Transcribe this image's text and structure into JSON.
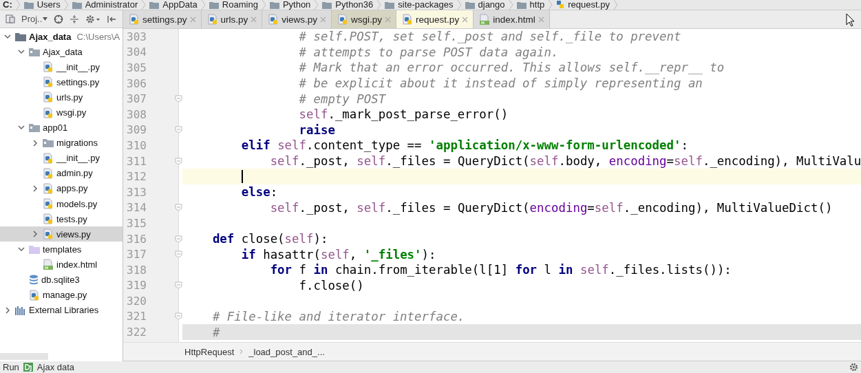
{
  "path_bar": [
    "C:",
    "Users",
    "Administrator",
    "AppData",
    "Roaming",
    "Python",
    "Python36",
    "site-packages",
    "django",
    "http",
    "request.py"
  ],
  "project_toolbar": {
    "label": "Proj.."
  },
  "tabs": [
    {
      "label": "settings.py",
      "kind": "py",
      "selected": false,
      "tinted": false
    },
    {
      "label": "urls.py",
      "kind": "py",
      "selected": false,
      "tinted": false
    },
    {
      "label": "views.py",
      "kind": "py",
      "selected": false,
      "tinted": false
    },
    {
      "label": "wsgi.py",
      "kind": "py",
      "selected": false,
      "tinted": true
    },
    {
      "label": "request.py",
      "kind": "py",
      "selected": true,
      "tinted": false
    },
    {
      "label": "index.html",
      "kind": "html",
      "selected": false,
      "tinted": false
    }
  ],
  "tree": [
    {
      "label": "Ajax_data",
      "kind": "project",
      "path": "C:\\Users\\A",
      "expanded": true,
      "selected": false,
      "children": [
        {
          "label": "Ajax_data",
          "kind": "folder",
          "expanded": true,
          "selected": false,
          "children": [
            {
              "label": "__init__.py",
              "kind": "py",
              "selected": false
            },
            {
              "label": "settings.py",
              "kind": "py",
              "selected": false
            },
            {
              "label": "urls.py",
              "kind": "py",
              "selected": false
            },
            {
              "label": "wsgi.py",
              "kind": "py",
              "selected": false
            }
          ]
        },
        {
          "label": "app01",
          "kind": "folder",
          "expanded": true,
          "selected": false,
          "children": [
            {
              "label": "migrations",
              "kind": "folder",
              "expanded": false,
              "selected": false
            },
            {
              "label": "__init__.py",
              "kind": "py",
              "selected": false
            },
            {
              "label": "admin.py",
              "kind": "py",
              "selected": false
            },
            {
              "label": "apps.py",
              "kind": "py",
              "expanded": false,
              "selected": false
            },
            {
              "label": "models.py",
              "kind": "py",
              "selected": false
            },
            {
              "label": "tests.py",
              "kind": "py",
              "selected": false
            },
            {
              "label": "views.py",
              "kind": "py",
              "expanded": false,
              "selected": true
            }
          ]
        },
        {
          "label": "templates",
          "kind": "template-folder",
          "expanded": true,
          "selected": false,
          "children": [
            {
              "label": "index.html",
              "kind": "html",
              "selected": false
            }
          ]
        },
        {
          "label": "db.sqlite3",
          "kind": "db",
          "selected": false
        },
        {
          "label": "manage.py",
          "kind": "py",
          "selected": false
        }
      ]
    },
    {
      "label": "External Libraries",
      "kind": "libraries",
      "expanded": false,
      "selected": false
    }
  ],
  "code": [
    {
      "number": "303",
      "fold": false,
      "current": false,
      "tokens": [
        {
          "kind": "comment",
          "t": "                # self.POST, set self._post and self._file to prevent"
        }
      ]
    },
    {
      "number": "304",
      "fold": false,
      "current": false,
      "tokens": [
        {
          "kind": "comment",
          "t": "                # attempts to parse POST data again."
        }
      ]
    },
    {
      "number": "305",
      "fold": false,
      "current": false,
      "tokens": [
        {
          "kind": "comment",
          "t": "                # Mark that an error occurred. This allows self.__repr__ to"
        }
      ]
    },
    {
      "number": "306",
      "fold": false,
      "current": false,
      "tokens": [
        {
          "kind": "comment",
          "t": "                # be explicit about it instead of simply representing an"
        }
      ]
    },
    {
      "number": "307",
      "fold": true,
      "current": false,
      "tokens": [
        {
          "kind": "comment",
          "t": "                # empty POST"
        }
      ]
    },
    {
      "number": "308",
      "fold": false,
      "current": false,
      "tokens": [
        {
          "kind": "self",
          "t": "                self"
        },
        {
          "kind": "plain",
          "t": "._mark_post_parse_error()"
        }
      ]
    },
    {
      "number": "309",
      "fold": true,
      "current": false,
      "tokens": [
        {
          "kind": "kw",
          "t": "                raise"
        }
      ]
    },
    {
      "number": "310",
      "fold": false,
      "current": false,
      "tokens": [
        {
          "kind": "kw",
          "t": "        elif "
        },
        {
          "kind": "self",
          "t": "self"
        },
        {
          "kind": "plain",
          "t": ".content_type == "
        },
        {
          "kind": "str",
          "t": "'application/x-www-form-urlencoded'"
        },
        {
          "kind": "plain",
          "t": ":"
        }
      ]
    },
    {
      "number": "311",
      "fold": true,
      "current": false,
      "tokens": [
        {
          "kind": "self",
          "t": "            self"
        },
        {
          "kind": "plain",
          "t": "._post, "
        },
        {
          "kind": "self",
          "t": "self"
        },
        {
          "kind": "plain",
          "t": "._files = QueryDict("
        },
        {
          "kind": "self",
          "t": "self"
        },
        {
          "kind": "plain",
          "t": ".body, "
        },
        {
          "kind": "param",
          "t": "encoding"
        },
        {
          "kind": "plain",
          "t": "="
        },
        {
          "kind": "self",
          "t": "self"
        },
        {
          "kind": "plain",
          "t": "._encoding), MultiValu"
        }
      ]
    },
    {
      "number": "312",
      "fold": false,
      "current": true
    },
    {
      "number": "313",
      "fold": false,
      "current": false,
      "tokens": [
        {
          "kind": "kw",
          "t": "        else"
        },
        {
          "kind": "plain",
          "t": ":"
        }
      ]
    },
    {
      "number": "314",
      "fold": true,
      "current": false,
      "tokens": [
        {
          "kind": "self",
          "t": "            self"
        },
        {
          "kind": "plain",
          "t": "._post, "
        },
        {
          "kind": "self",
          "t": "self"
        },
        {
          "kind": "plain",
          "t": "._files = QueryDict("
        },
        {
          "kind": "param",
          "t": "encoding"
        },
        {
          "kind": "plain",
          "t": "="
        },
        {
          "kind": "self",
          "t": "self"
        },
        {
          "kind": "plain",
          "t": "._encoding), MultiValueDict()"
        }
      ]
    },
    {
      "number": "315",
      "fold": false,
      "current": false
    },
    {
      "number": "316",
      "fold": true,
      "current": false,
      "tokens": [
        {
          "kind": "kw",
          "t": "    def "
        },
        {
          "kind": "plain",
          "t": "close("
        },
        {
          "kind": "self",
          "t": "self"
        },
        {
          "kind": "plain",
          "t": "):"
        }
      ]
    },
    {
      "number": "317",
      "fold": true,
      "current": false,
      "tokens": [
        {
          "kind": "kw",
          "t": "        if "
        },
        {
          "kind": "plain",
          "t": "hasattr("
        },
        {
          "kind": "self",
          "t": "self"
        },
        {
          "kind": "plain",
          "t": ", "
        },
        {
          "kind": "str",
          "t": "'_files'"
        },
        {
          "kind": "plain",
          "t": "):"
        }
      ]
    },
    {
      "number": "318",
      "fold": false,
      "current": false,
      "tokens": [
        {
          "kind": "kw",
          "t": "            for "
        },
        {
          "kind": "plain",
          "t": "f "
        },
        {
          "kind": "kw",
          "t": "in "
        },
        {
          "kind": "plain",
          "t": "chain.from_iterable(l[1] "
        },
        {
          "kind": "kw",
          "t": "for "
        },
        {
          "kind": "plain",
          "t": "l "
        },
        {
          "kind": "kw",
          "t": "in "
        },
        {
          "kind": "self",
          "t": "self"
        },
        {
          "kind": "plain",
          "t": "._files.lists()):"
        }
      ]
    },
    {
      "number": "319",
      "fold": true,
      "current": false,
      "tokens": [
        {
          "kind": "plain",
          "t": "                f.close()"
        }
      ]
    },
    {
      "number": "320",
      "fold": false,
      "current": false
    },
    {
      "number": "321",
      "fold": true,
      "current": false,
      "tokens": [
        {
          "kind": "comment",
          "t": "    # File-like and iterator interface."
        }
      ]
    },
    {
      "number": "322",
      "fold": false,
      "current": false,
      "shaded": true,
      "tokens": [
        {
          "kind": "comment",
          "t": "    #"
        }
      ]
    }
  ],
  "code_breadcrumb": [
    "HttpRequest",
    "_load_post_and_..."
  ],
  "bottom_bar": {
    "label": "Run",
    "config": "Ajax data"
  }
}
